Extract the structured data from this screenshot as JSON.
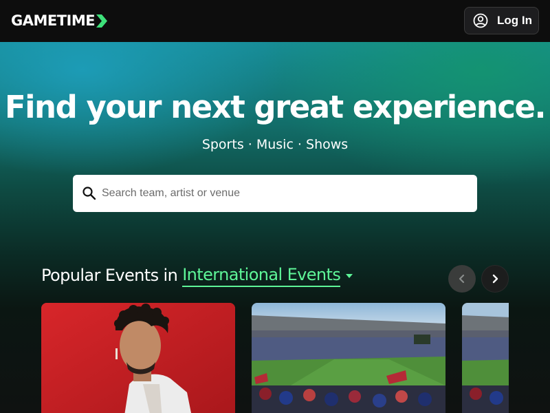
{
  "header": {
    "logo_text": "GAMETIME",
    "login_label": "Log In",
    "login_icon": "user-circle-icon"
  },
  "hero": {
    "title": "Find your next great experience.",
    "subtitle": "Sports · Music · Shows"
  },
  "search": {
    "placeholder": "Search team, artist or venue",
    "value": "",
    "icon": "search-icon"
  },
  "popular": {
    "title": "Popular Events in",
    "region": "International Events",
    "prev_icon": "chevron-left-icon",
    "next_icon": "chevron-right-icon",
    "cards": [
      {
        "image": "artist-portrait"
      },
      {
        "image": "stadium-crowd"
      },
      {
        "image": "stadium-crowd"
      }
    ]
  },
  "colors": {
    "accent_green": "#5ef598",
    "header_bg": "#0d0d0d",
    "card_1_bg": "#c81e22"
  }
}
